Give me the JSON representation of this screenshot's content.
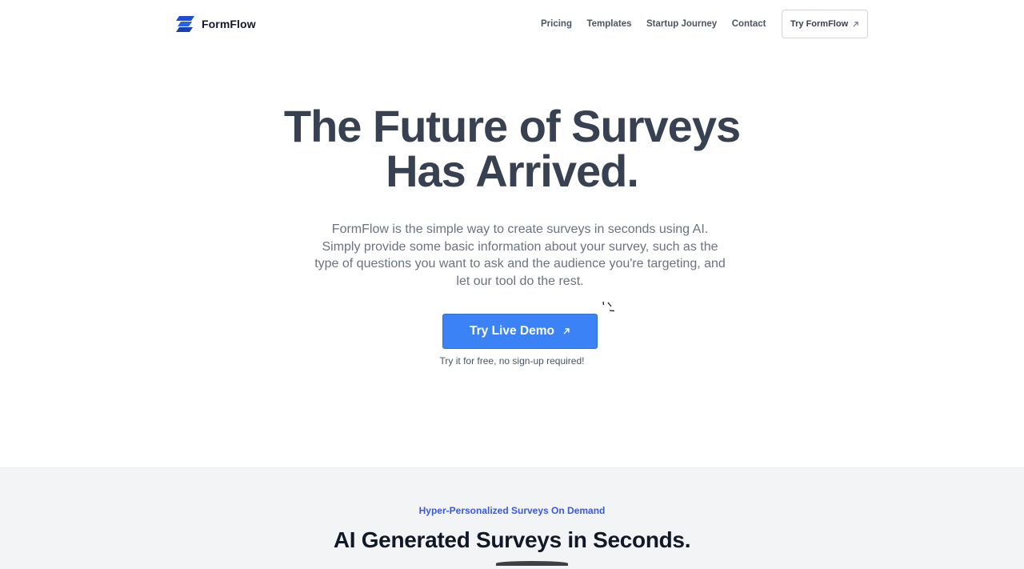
{
  "brand": {
    "name": "FormFlow",
    "logo_icon": "formflow-logo-icon",
    "logo_colors": [
      "#1d4ed8",
      "#3b5bdb"
    ]
  },
  "nav": {
    "links": [
      {
        "label": "Pricing"
      },
      {
        "label": "Templates"
      },
      {
        "label": "Startup Journey"
      },
      {
        "label": "Contact"
      }
    ],
    "cta_label": "Try FormFlow",
    "cta_icon": "arrow-up-right-icon"
  },
  "hero": {
    "title_line1": "The Future of Surveys",
    "title_line2": "Has Arrived.",
    "subtitle": "FormFlow is the simple way to create surveys in seconds using AI. Simply provide some basic information about your survey, such as the type of questions you want to ask and the audience you're targeting, and let our tool do the rest.",
    "demo_label": "Try Live Demo",
    "demo_icon": "arrow-up-right-icon",
    "demo_note": "Try it for free, no sign-up required!",
    "accent_color": "#3b82f6"
  },
  "section2": {
    "eyebrow": "Hyper-Personalized Surveys On Demand",
    "title": "AI Generated Surveys in Seconds."
  }
}
